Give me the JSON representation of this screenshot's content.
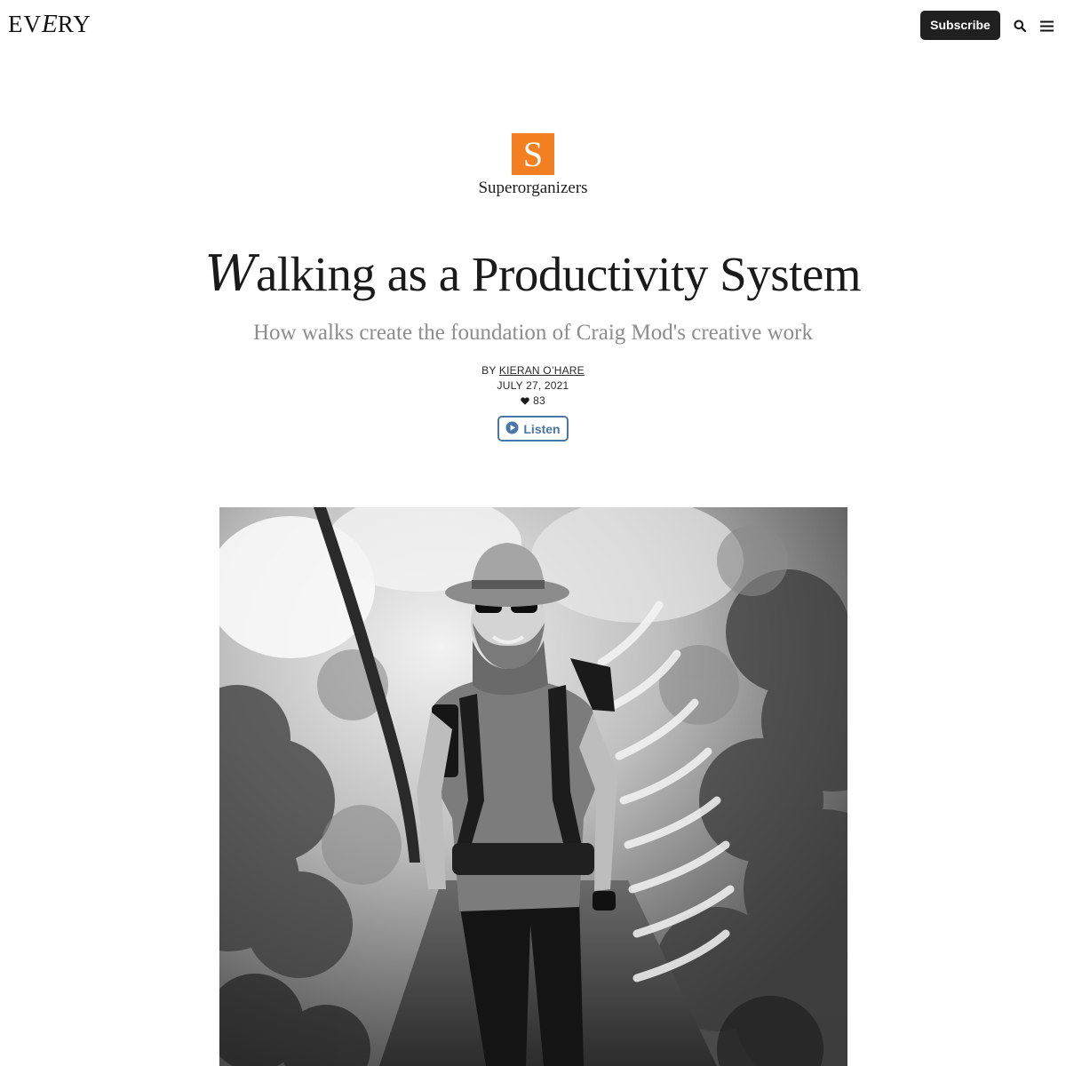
{
  "header": {
    "logo_left": "EV",
    "logo_mid": "E",
    "logo_right": "RY",
    "subscribe_label": "Subscribe",
    "search_icon": "search-icon",
    "menu_icon": "hamburger-menu-icon"
  },
  "publication": {
    "logo_letter": "S",
    "logo_color": "#f47f20",
    "name": "Superorganizers"
  },
  "article": {
    "title_dropcap": "W",
    "title_rest": "alking as a Productivity System",
    "subtitle": "How walks create the foundation of Craig Mod's creative work",
    "byline_prefix": "BY",
    "author": "KIERAN O’HARE",
    "date": "JULY 27, 2021",
    "likes": "83",
    "listen_label": "Listen"
  },
  "hero_image": {
    "description_icon": "photo",
    "style": "black-and-white"
  },
  "colors": {
    "accent_blue": "#4a77a8",
    "subscribe_bg": "#202020"
  }
}
